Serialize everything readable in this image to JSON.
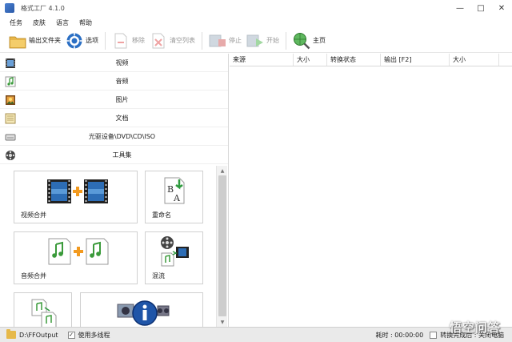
{
  "window": {
    "title": "格式工厂 4.1.0",
    "controls": [
      "—",
      "□",
      "✕"
    ]
  },
  "menu": [
    "任务",
    "皮肤",
    "语言",
    "帮助"
  ],
  "toolbar": {
    "output_folder": "输出文件夹",
    "options": "选项",
    "remove": "移除",
    "clear_list": "清空列表",
    "stop": "停止",
    "start": "开始",
    "home": "主页"
  },
  "categories": [
    {
      "label": "视频",
      "icon": "film-icon"
    },
    {
      "label": "音频",
      "icon": "music-note-icon"
    },
    {
      "label": "图片",
      "icon": "picture-icon"
    },
    {
      "label": "文档",
      "icon": "document-icon"
    },
    {
      "label": "光驱设备\\DVD\\CD\\ISO",
      "icon": "disc-drive-icon"
    },
    {
      "label": "工具集",
      "icon": "tools-reel-icon"
    }
  ],
  "tools": {
    "video_merge": "视频合并",
    "rename": "重命名",
    "audio_merge": "音频合并",
    "mux": "混流"
  },
  "table": {
    "columns": [
      "来源",
      "大小",
      "转换状态",
      "输出 [F2]",
      "大小"
    ]
  },
  "status": {
    "output_path": "D:\\FFOutput",
    "multithread_label": "使用多线程",
    "multithread_checked": true,
    "elapsed_label": "耗时 : 00:00:00",
    "after_convert_label": "转换完成后 : 关闭电脑",
    "watermark": "悟空问答"
  },
  "colors": {
    "accent_green": "#2e9a3e",
    "film_blue": "#2d6db5",
    "plus_orange": "#f29a1f",
    "folder_yellow": "#e6b94a"
  }
}
